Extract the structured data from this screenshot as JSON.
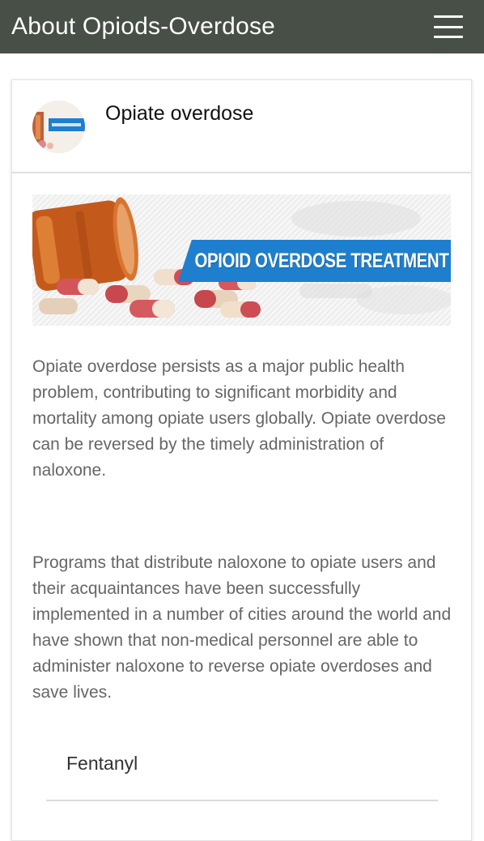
{
  "app_bar": {
    "title": "About Opiods-Overdose",
    "menu_icon": "hamburger-menu-icon"
  },
  "card": {
    "avatar_icon": "opioid-thumbnail-icon",
    "title": "Opiate overdose",
    "banner": {
      "text": "OPIOID OVERDOSE TREATMENT",
      "accent_color": "#1f7fcf"
    },
    "paragraphs": [
      "Opiate overdose persists as a major public health problem, contributing to significant morbidity and mortality among opiate users globally. Opiate overdose can be reversed by the timely administration of naloxone.",
      "Programs that distribute naloxone to opiate users and their acquaintances have been successfully implemented in a number of cities around the world and have shown that non-medical personnel are able to administer naloxone to reverse opiate overdoses and save lives."
    ],
    "list_items": [
      {
        "label": "Fentanyl"
      }
    ]
  },
  "colors": {
    "app_bar_bg": "#474f46",
    "body_text": "#666666"
  }
}
